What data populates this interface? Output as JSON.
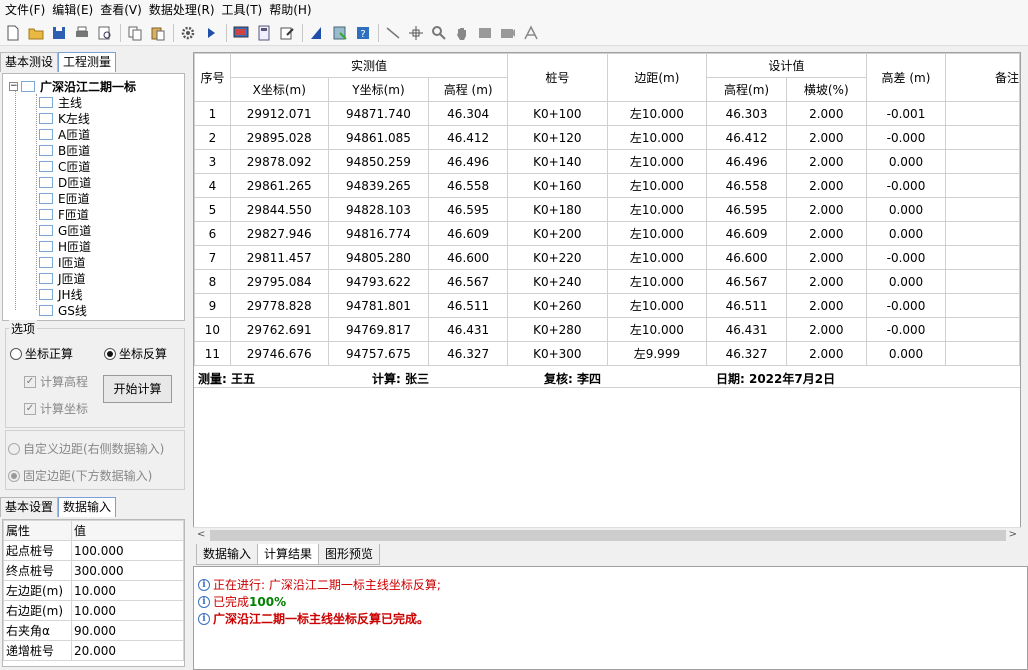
{
  "menu": [
    "文件(F)",
    "编辑(E)",
    "查看(V)",
    "数据处理(R)",
    "工具(T)",
    "帮助(H)"
  ],
  "toolbar_icons": [
    "new-file-icon",
    "open-folder-icon",
    "save-icon",
    "print-icon",
    "print-preview-icon",
    "copy-icon",
    "paste-icon",
    "settings-icon",
    "run-icon",
    "screen-icon",
    "calculator-icon",
    "edit-icon",
    "chart-icon",
    "export-icon",
    "help-icon",
    "line-tool-icon",
    "crosshair-icon",
    "zoom-icon",
    "pan-hand-icon",
    "rect-icon",
    "camera-icon",
    "measure-icon"
  ],
  "left_tabs": [
    "基本测设",
    "工程测量"
  ],
  "tree": {
    "root": "广深沿江二期一标",
    "items": [
      "主线",
      "K左线",
      "A匝道",
      "B匝道",
      "C匝道",
      "D匝道",
      "E匝道",
      "F匝道",
      "G匝道",
      "H匝道",
      "I匝道",
      "J匝道",
      "JH线",
      "GS线"
    ]
  },
  "options": {
    "legend": "选项",
    "radio_forward": "坐标正算",
    "radio_inverse": "坐标反算",
    "calc_height": "计算高程",
    "calc_coord": "计算坐标",
    "start_button": "开始计算",
    "custom_offset": "自定义边距(右侧数据输入)",
    "fixed_offset": "固定边距(下方数据输入)"
  },
  "bottom_tabs": [
    "基本设置",
    "数据输入"
  ],
  "props": {
    "header": [
      "属性",
      "值"
    ],
    "rows": [
      [
        "起点桩号",
        "100.000"
      ],
      [
        "终点桩号",
        "300.000"
      ],
      [
        "左边距(m)",
        "10.000"
      ],
      [
        "右边距(m)",
        "10.000"
      ],
      [
        "右夹角α",
        "90.000"
      ],
      [
        "递增桩号",
        "20.000"
      ]
    ]
  },
  "grid": {
    "headers": {
      "seq": "序号",
      "measured": "实测值",
      "x": "X坐标(m)",
      "y": "Y坐标(m)",
      "elev": "高程 (m)",
      "station": "桩号",
      "offset": "边距(m)",
      "design": "设计值",
      "design_elev": "高程(m)",
      "slope": "横坡(%)",
      "diff": "高差 (m)",
      "remark": "备注"
    },
    "rows": [
      [
        "1",
        "29912.071",
        "94871.740",
        "46.304",
        "K0+100",
        "左10.000",
        "46.303",
        "2.000",
        "-0.001",
        ""
      ],
      [
        "2",
        "29895.028",
        "94861.085",
        "46.412",
        "K0+120",
        "左10.000",
        "46.412",
        "2.000",
        "-0.000",
        ""
      ],
      [
        "3",
        "29878.092",
        "94850.259",
        "46.496",
        "K0+140",
        "左10.000",
        "46.496",
        "2.000",
        "0.000",
        ""
      ],
      [
        "4",
        "29861.265",
        "94839.265",
        "46.558",
        "K0+160",
        "左10.000",
        "46.558",
        "2.000",
        "-0.000",
        ""
      ],
      [
        "5",
        "29844.550",
        "94828.103",
        "46.595",
        "K0+180",
        "左10.000",
        "46.595",
        "2.000",
        "0.000",
        ""
      ],
      [
        "6",
        "29827.946",
        "94816.774",
        "46.609",
        "K0+200",
        "左10.000",
        "46.609",
        "2.000",
        "0.000",
        ""
      ],
      [
        "7",
        "29811.457",
        "94805.280",
        "46.600",
        "K0+220",
        "左10.000",
        "46.600",
        "2.000",
        "-0.000",
        ""
      ],
      [
        "8",
        "29795.084",
        "94793.622",
        "46.567",
        "K0+240",
        "左10.000",
        "46.567",
        "2.000",
        "0.000",
        ""
      ],
      [
        "9",
        "29778.828",
        "94781.801",
        "46.511",
        "K0+260",
        "左10.000",
        "46.511",
        "2.000",
        "-0.000",
        ""
      ],
      [
        "10",
        "29762.691",
        "94769.817",
        "46.431",
        "K0+280",
        "左10.000",
        "46.431",
        "2.000",
        "-0.000",
        ""
      ],
      [
        "11",
        "29746.676",
        "94757.675",
        "46.327",
        "K0+300",
        "左9.999",
        "46.327",
        "2.000",
        "0.000",
        ""
      ]
    ],
    "footer": {
      "surveyor": "测量: 王五",
      "calculator": "计算: 张三",
      "checker": "复核: 李四",
      "date": "日期: 2022年7月2日"
    }
  },
  "mid_tabs": [
    "数据输入",
    "计算结果",
    "图形预览"
  ],
  "log": {
    "line1": "正在进行: 广深沿江二期一标主线坐标反算;",
    "line2_prefix": "已完成",
    "line2_value": "100%",
    "line3": "广深沿江二期一标主线坐标反算已完成。",
    "colors": {
      "red": "#cc0000",
      "green": "#008000"
    }
  }
}
